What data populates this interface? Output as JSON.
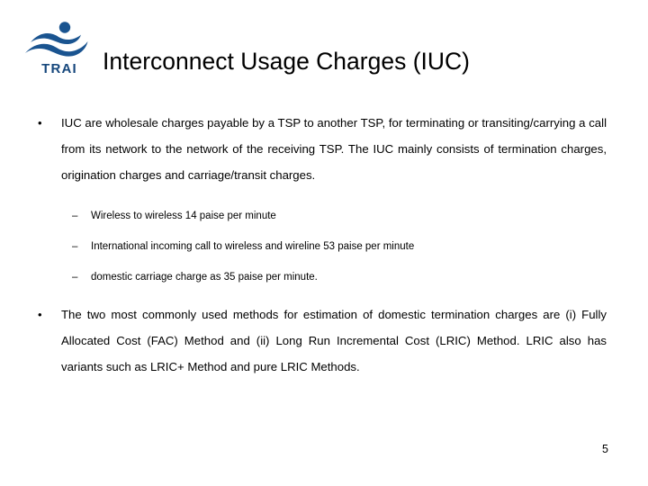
{
  "slide": {
    "title": "Interconnect Usage Charges (IUC)",
    "page_number": "5",
    "logo": {
      "name": "trai-logo",
      "wordmark": "TRAI",
      "color": "#1a5490",
      "wordmark_color": "#16477c"
    },
    "bullets": [
      {
        "marker": "•",
        "text": "IUC are wholesale charges payable by a TSP to another TSP, for terminating or transiting/carrying a call from its network to the network of the receiving TSP. The IUC mainly consists of termination charges, origination charges and carriage/transit charges.",
        "sub_marker": "–",
        "sub_items": [
          "Wireless to wireless  14 paise per minute",
          "International incoming call to wireless and wireline 53 paise per minute",
          "domestic carriage charge as 35 paise per minute."
        ]
      },
      {
        "marker": "•",
        "text": "The two most commonly used methods for estimation of domestic termination charges are (i) Fully Allocated Cost (FAC) Method and (ii) Long Run Incremental Cost (LRIC) Method. LRIC also has variants such as LRIC+ Method and pure LRIC Methods.",
        "sub_marker": "",
        "sub_items": []
      }
    ]
  }
}
